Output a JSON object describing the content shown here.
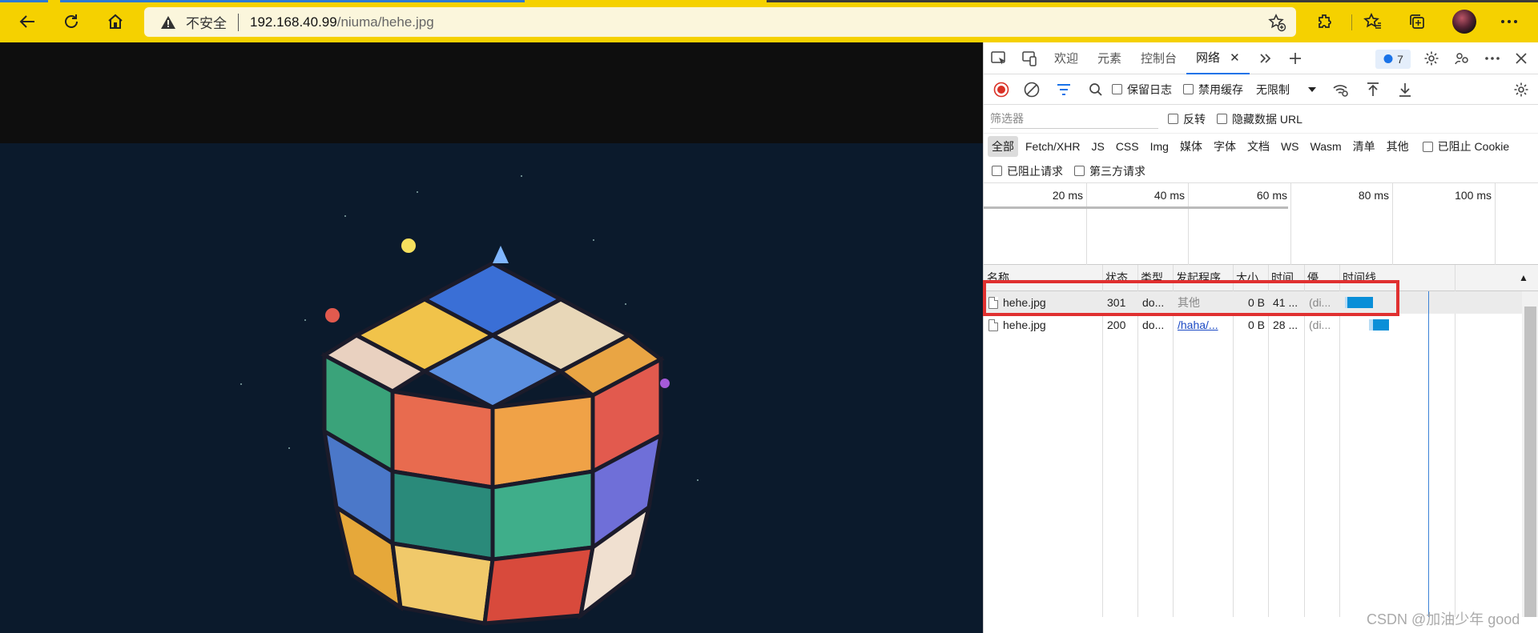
{
  "browser": {
    "security_label": "不安全",
    "url_host": "192.168.40.99",
    "url_path": "/niuma/hehe.jpg"
  },
  "devtools": {
    "tabs": [
      {
        "label": "欢迎"
      },
      {
        "label": "元素"
      },
      {
        "label": "控制台"
      },
      {
        "label": "网络",
        "active": true
      }
    ],
    "issues_count": "7",
    "toolbar": {
      "preserve_log": "保留日志",
      "disable_cache": "禁用缓存",
      "throttling": "无限制"
    },
    "filter": {
      "placeholder": "筛选器",
      "invert": "反转",
      "hide_data_urls": "隐藏数据 URL"
    },
    "type_filters": [
      "全部",
      "Fetch/XHR",
      "JS",
      "CSS",
      "Img",
      "媒体",
      "字体",
      "文档",
      "WS",
      "Wasm",
      "清单",
      "其他"
    ],
    "blocked_cookies": "已阻止 Cookie",
    "blocked_requests": "已阻止请求",
    "third_party": "第三方请求",
    "overview_ticks": [
      "20 ms",
      "40 ms",
      "60 ms",
      "80 ms",
      "100 ms"
    ],
    "columns": [
      "名称",
      "状态",
      "类型",
      "发起程序",
      "大小",
      "时间",
      "優",
      "时间线"
    ],
    "requests": [
      {
        "name": "hehe.jpg",
        "status": "301",
        "type": "do...",
        "initiator": "其他",
        "size": "0 B",
        "time": "41 ...",
        "priority": "(di..."
      },
      {
        "name": "hehe.jpg",
        "status": "200",
        "type": "do...",
        "initiator": "/haha/...",
        "size": "0 B",
        "time": "28 ...",
        "priority": "(di..."
      }
    ]
  },
  "watermark": "CSDN @加油少年 good",
  "colors": {
    "chrome_bar": "#f5d100",
    "highlight": "#e03030",
    "waterfall": "#0a8fd8"
  }
}
